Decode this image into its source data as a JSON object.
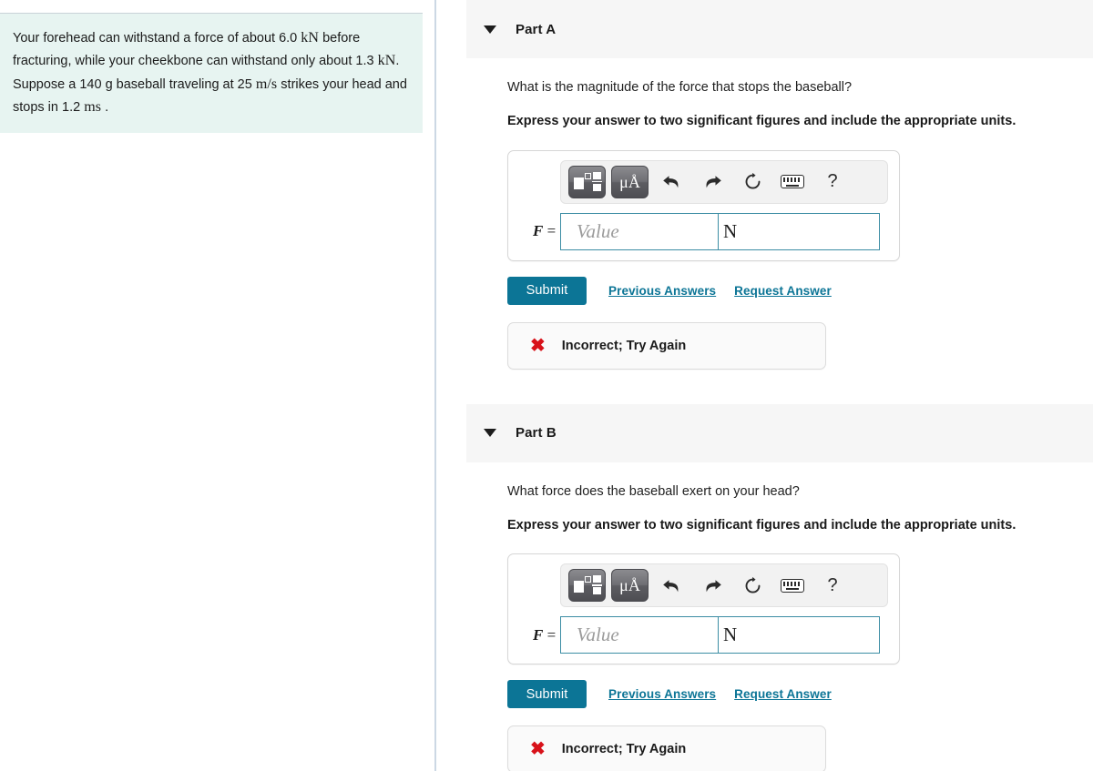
{
  "problem": {
    "segments": [
      {
        "text": "Your forehead can withstand a force of about 6.0 ",
        "math": false
      },
      {
        "text": "kN",
        "math": true
      },
      {
        "text": " before fracturing, while your cheekbone can withstand only about 1.3 ",
        "math": false
      },
      {
        "text": "kN",
        "math": true
      },
      {
        "text": ". Suppose a 140 g baseball traveling at 25 ",
        "math": false
      },
      {
        "text": "m/s",
        "math": true
      },
      {
        "text": " strikes your head and stops in 1.2 ",
        "math": false
      },
      {
        "text": "ms",
        "math": true
      },
      {
        "text": " .",
        "math": false
      }
    ],
    "full_text": "Your forehead can withstand a force of about 6.0 kN before fracturing, while your cheekbone can withstand only about 1.3 kN. Suppose a 140 g baseball traveling at 25 m/s strikes your head and stops in 1.2 ms ."
  },
  "toolbar": {
    "template_icon": "math-template-icon",
    "units_label": "μÅ",
    "undo_glyph": "⬅",
    "redo_glyph": "➡",
    "reset_glyph": "↻",
    "keyboard_icon": "keyboard-icon",
    "help_label": "?"
  },
  "colors": {
    "accent": "#0c7596",
    "input_border": "#3c8da4",
    "error": "#d8121a",
    "statement_bg": "#e7f4f1",
    "header_bg": "#f6f6f6"
  },
  "parts": [
    {
      "id": "part-a",
      "title": "Part A",
      "question": "What is the magnitude of the force that stops the baseball?",
      "instruction": "Express your answer to two significant figures and include the appropriate units.",
      "variable": "F",
      "equals": "=",
      "value": "",
      "value_placeholder": "Value",
      "unit": "N",
      "submit_label": "Submit",
      "previous_answers_label": "Previous Answers",
      "request_answer_label": "Request Answer",
      "feedback_mark": "✖",
      "feedback_text": "Incorrect; Try Again"
    },
    {
      "id": "part-b",
      "title": "Part B",
      "question": "What force does the baseball exert on your head?",
      "instruction": "Express your answer to two significant figures and include the appropriate units.",
      "variable": "F",
      "equals": "=",
      "value": "",
      "value_placeholder": "Value",
      "unit": "N",
      "submit_label": "Submit",
      "previous_answers_label": "Previous Answers",
      "request_answer_label": "Request Answer",
      "feedback_mark": "✖",
      "feedback_text": "Incorrect; Try Again"
    }
  ]
}
